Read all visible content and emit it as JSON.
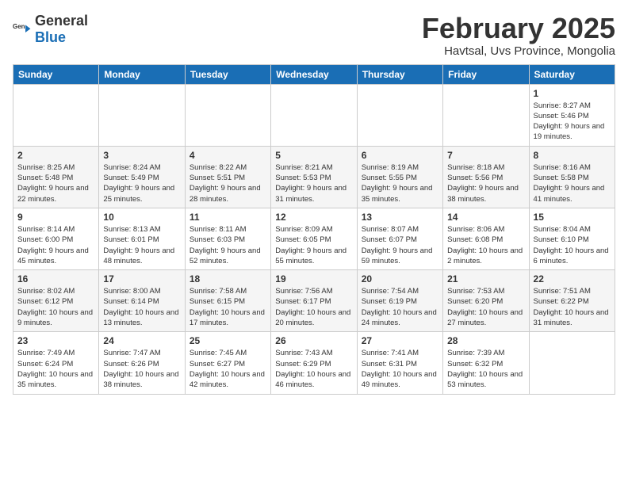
{
  "logo": {
    "general": "General",
    "blue": "Blue"
  },
  "header": {
    "title": "February 2025",
    "subtitle": "Havtsal, Uvs Province, Mongolia"
  },
  "weekdays": [
    "Sunday",
    "Monday",
    "Tuesday",
    "Wednesday",
    "Thursday",
    "Friday",
    "Saturday"
  ],
  "weeks": [
    [
      {
        "day": "",
        "info": ""
      },
      {
        "day": "",
        "info": ""
      },
      {
        "day": "",
        "info": ""
      },
      {
        "day": "",
        "info": ""
      },
      {
        "day": "",
        "info": ""
      },
      {
        "day": "",
        "info": ""
      },
      {
        "day": "1",
        "info": "Sunrise: 8:27 AM\nSunset: 5:46 PM\nDaylight: 9 hours and 19 minutes."
      }
    ],
    [
      {
        "day": "2",
        "info": "Sunrise: 8:25 AM\nSunset: 5:48 PM\nDaylight: 9 hours and 22 minutes."
      },
      {
        "day": "3",
        "info": "Sunrise: 8:24 AM\nSunset: 5:49 PM\nDaylight: 9 hours and 25 minutes."
      },
      {
        "day": "4",
        "info": "Sunrise: 8:22 AM\nSunset: 5:51 PM\nDaylight: 9 hours and 28 minutes."
      },
      {
        "day": "5",
        "info": "Sunrise: 8:21 AM\nSunset: 5:53 PM\nDaylight: 9 hours and 31 minutes."
      },
      {
        "day": "6",
        "info": "Sunrise: 8:19 AM\nSunset: 5:55 PM\nDaylight: 9 hours and 35 minutes."
      },
      {
        "day": "7",
        "info": "Sunrise: 8:18 AM\nSunset: 5:56 PM\nDaylight: 9 hours and 38 minutes."
      },
      {
        "day": "8",
        "info": "Sunrise: 8:16 AM\nSunset: 5:58 PM\nDaylight: 9 hours and 41 minutes."
      }
    ],
    [
      {
        "day": "9",
        "info": "Sunrise: 8:14 AM\nSunset: 6:00 PM\nDaylight: 9 hours and 45 minutes."
      },
      {
        "day": "10",
        "info": "Sunrise: 8:13 AM\nSunset: 6:01 PM\nDaylight: 9 hours and 48 minutes."
      },
      {
        "day": "11",
        "info": "Sunrise: 8:11 AM\nSunset: 6:03 PM\nDaylight: 9 hours and 52 minutes."
      },
      {
        "day": "12",
        "info": "Sunrise: 8:09 AM\nSunset: 6:05 PM\nDaylight: 9 hours and 55 minutes."
      },
      {
        "day": "13",
        "info": "Sunrise: 8:07 AM\nSunset: 6:07 PM\nDaylight: 9 hours and 59 minutes."
      },
      {
        "day": "14",
        "info": "Sunrise: 8:06 AM\nSunset: 6:08 PM\nDaylight: 10 hours and 2 minutes."
      },
      {
        "day": "15",
        "info": "Sunrise: 8:04 AM\nSunset: 6:10 PM\nDaylight: 10 hours and 6 minutes."
      }
    ],
    [
      {
        "day": "16",
        "info": "Sunrise: 8:02 AM\nSunset: 6:12 PM\nDaylight: 10 hours and 9 minutes."
      },
      {
        "day": "17",
        "info": "Sunrise: 8:00 AM\nSunset: 6:14 PM\nDaylight: 10 hours and 13 minutes."
      },
      {
        "day": "18",
        "info": "Sunrise: 7:58 AM\nSunset: 6:15 PM\nDaylight: 10 hours and 17 minutes."
      },
      {
        "day": "19",
        "info": "Sunrise: 7:56 AM\nSunset: 6:17 PM\nDaylight: 10 hours and 20 minutes."
      },
      {
        "day": "20",
        "info": "Sunrise: 7:54 AM\nSunset: 6:19 PM\nDaylight: 10 hours and 24 minutes."
      },
      {
        "day": "21",
        "info": "Sunrise: 7:53 AM\nSunset: 6:20 PM\nDaylight: 10 hours and 27 minutes."
      },
      {
        "day": "22",
        "info": "Sunrise: 7:51 AM\nSunset: 6:22 PM\nDaylight: 10 hours and 31 minutes."
      }
    ],
    [
      {
        "day": "23",
        "info": "Sunrise: 7:49 AM\nSunset: 6:24 PM\nDaylight: 10 hours and 35 minutes."
      },
      {
        "day": "24",
        "info": "Sunrise: 7:47 AM\nSunset: 6:26 PM\nDaylight: 10 hours and 38 minutes."
      },
      {
        "day": "25",
        "info": "Sunrise: 7:45 AM\nSunset: 6:27 PM\nDaylight: 10 hours and 42 minutes."
      },
      {
        "day": "26",
        "info": "Sunrise: 7:43 AM\nSunset: 6:29 PM\nDaylight: 10 hours and 46 minutes."
      },
      {
        "day": "27",
        "info": "Sunrise: 7:41 AM\nSunset: 6:31 PM\nDaylight: 10 hours and 49 minutes."
      },
      {
        "day": "28",
        "info": "Sunrise: 7:39 AM\nSunset: 6:32 PM\nDaylight: 10 hours and 53 minutes."
      },
      {
        "day": "",
        "info": ""
      }
    ]
  ]
}
